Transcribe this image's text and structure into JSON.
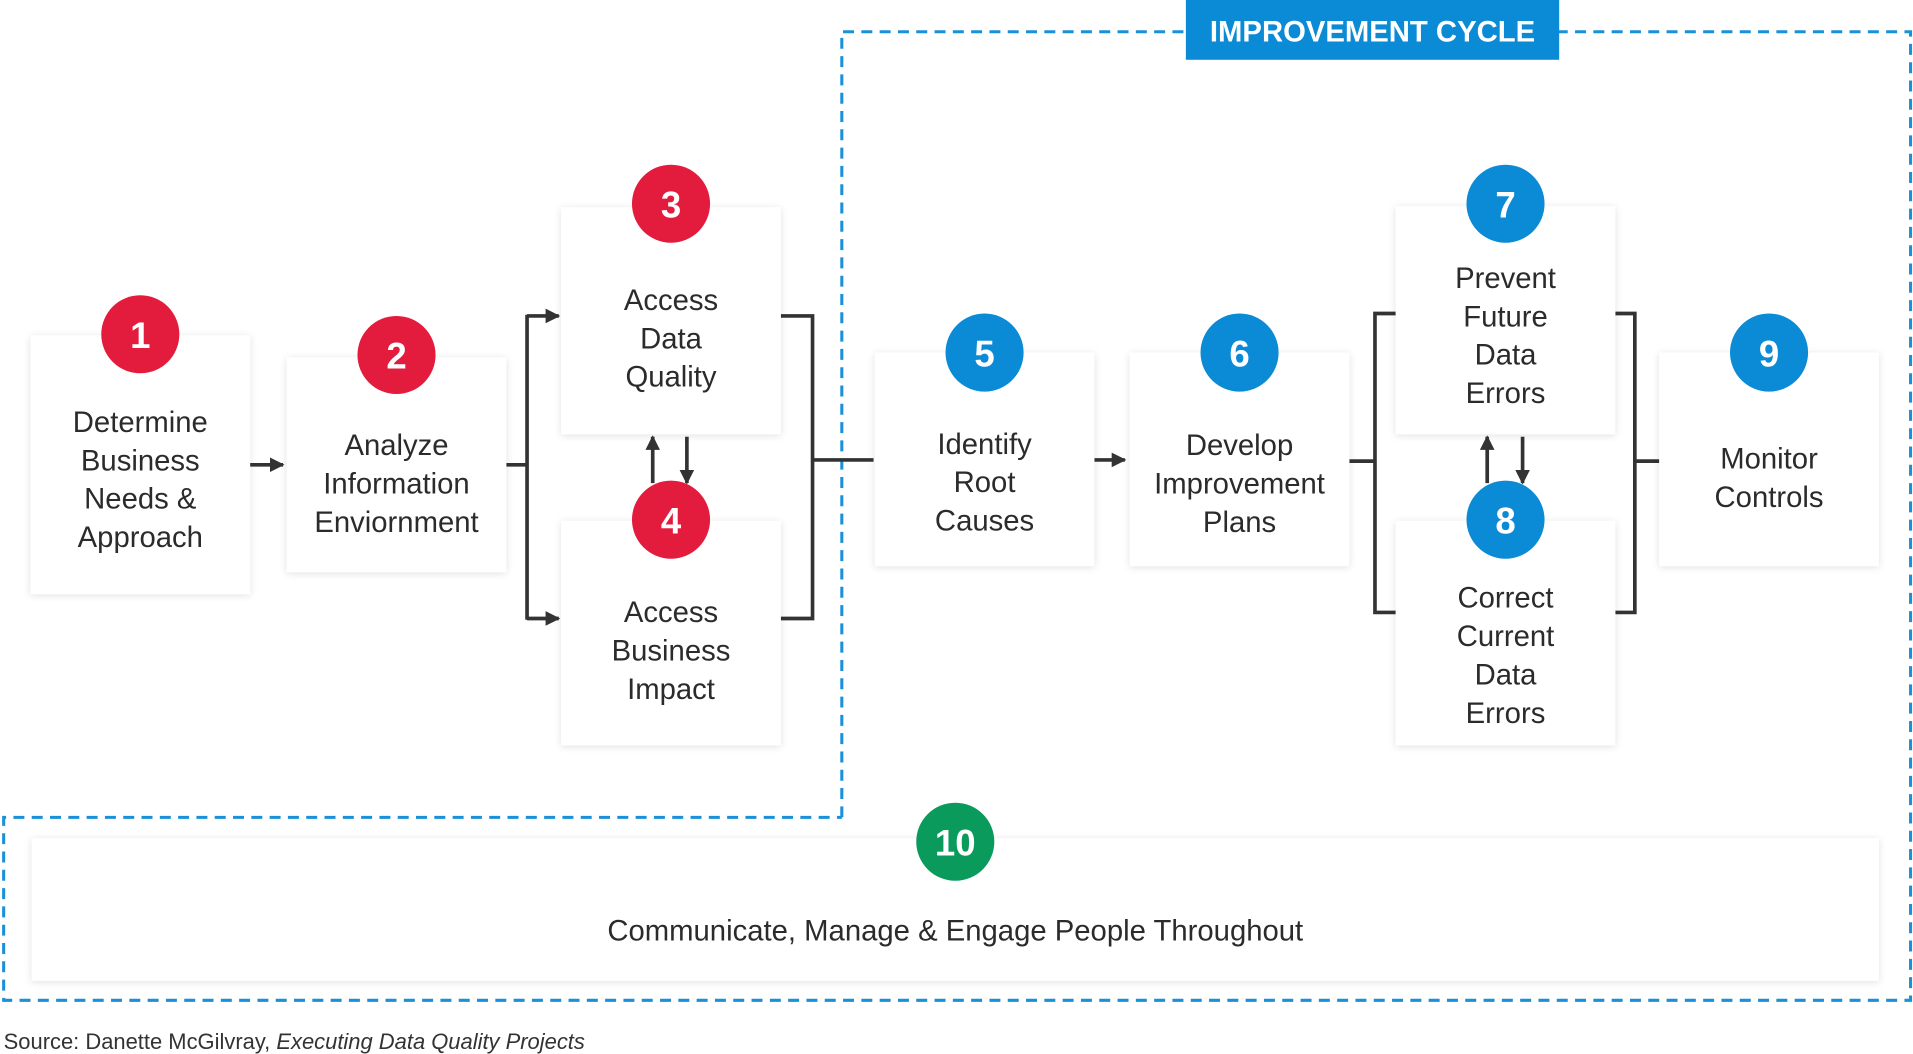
{
  "cycle_label": "IMPROVEMENT CYCLE",
  "colors": {
    "red": "#e31b3c",
    "blue": "#0b8ad6",
    "green": "#0a9a5c",
    "dash": "#1a90d8"
  },
  "steps": [
    {
      "num": "1",
      "color": "red",
      "lines": [
        "Determine",
        "Business",
        "Needs &",
        "Approach"
      ]
    },
    {
      "num": "2",
      "color": "red",
      "lines": [
        "Analyze",
        "Information",
        "Enviornment"
      ]
    },
    {
      "num": "3",
      "color": "red",
      "lines": [
        "Access",
        "Data",
        "Quality"
      ]
    },
    {
      "num": "4",
      "color": "red",
      "lines": [
        "Access",
        "Business",
        "Impact"
      ]
    },
    {
      "num": "5",
      "color": "blue",
      "lines": [
        "Identify",
        "Root",
        "Causes"
      ]
    },
    {
      "num": "6",
      "color": "blue",
      "lines": [
        "Develop",
        "Improvement",
        "Plans"
      ]
    },
    {
      "num": "7",
      "color": "blue",
      "lines": [
        "Prevent",
        "Future",
        "Data",
        "Errors"
      ]
    },
    {
      "num": "8",
      "color": "blue",
      "lines": [
        "Correct",
        "Current",
        "Data",
        "Errors"
      ]
    },
    {
      "num": "9",
      "color": "blue",
      "lines": [
        "Monitor",
        "Controls"
      ]
    },
    {
      "num": "10",
      "color": "green",
      "lines": [
        "Communicate, Manage & Engage People Throughout"
      ]
    }
  ],
  "source": {
    "prefix": "Source: Danette McGilvray, ",
    "title": "Executing Data Quality Projects"
  }
}
